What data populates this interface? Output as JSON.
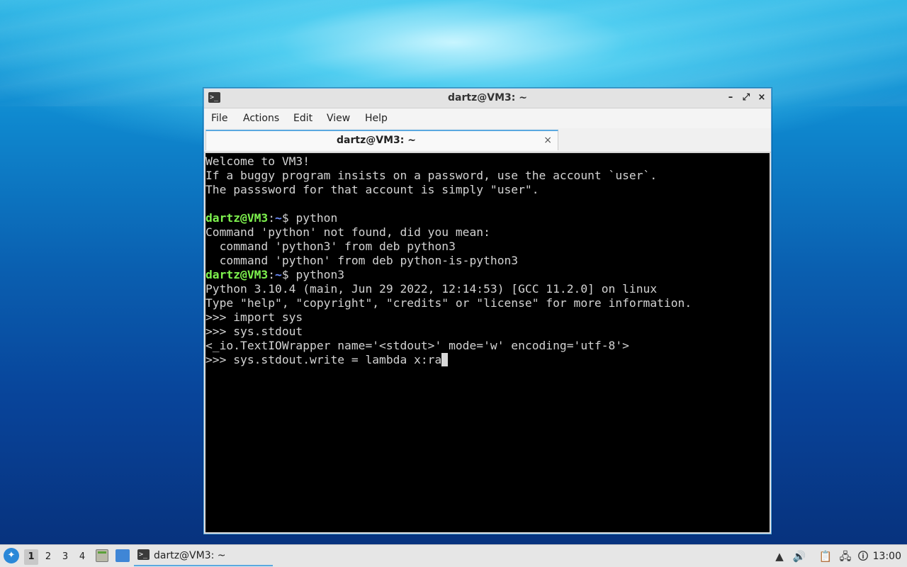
{
  "window": {
    "title": "dartz@VM3: ~",
    "icon": "terminal-icon",
    "controls": {
      "minimize": "–",
      "maximize": "⤢",
      "close": "×"
    }
  },
  "menubar": {
    "items": [
      "File",
      "Actions",
      "Edit",
      "View",
      "Help"
    ]
  },
  "tabs": [
    {
      "label": "dartz@VM3: ~",
      "close": "×"
    }
  ],
  "terminal": {
    "lines": [
      "Welcome to VM3!",
      "If a buggy program insists on a password, use the account `user`.",
      "The passsword for that account is simply \"user\".",
      "",
      "Command 'python' not found, did you mean:",
      "  command 'python3' from deb python3",
      "  command 'python' from deb python-is-python3",
      "Python 3.10.4 (main, Jun 29 2022, 12:14:53) [GCC 11.2.0] on linux",
      "Type \"help\", \"copyright\", \"credits\" or \"license\" for more information.",
      ">>> import sys",
      ">>> sys.stdout",
      "<_io.TextIOWrapper name='<stdout>' mode='w' encoding='utf-8'>",
      ">>> sys.stdout.write = lambda x:ra"
    ],
    "prompt": {
      "user": "dartz@VM3",
      "sep": ":",
      "path": "~",
      "symbol": "$ "
    },
    "commands": [
      "python",
      "python3"
    ]
  },
  "taskbar": {
    "workspaces": [
      "1",
      "2",
      "3",
      "4"
    ],
    "active_workspace": "1",
    "task_label": "dartz@VM3: ~",
    "clock": "13:00",
    "accent": "#5aa8e0"
  }
}
